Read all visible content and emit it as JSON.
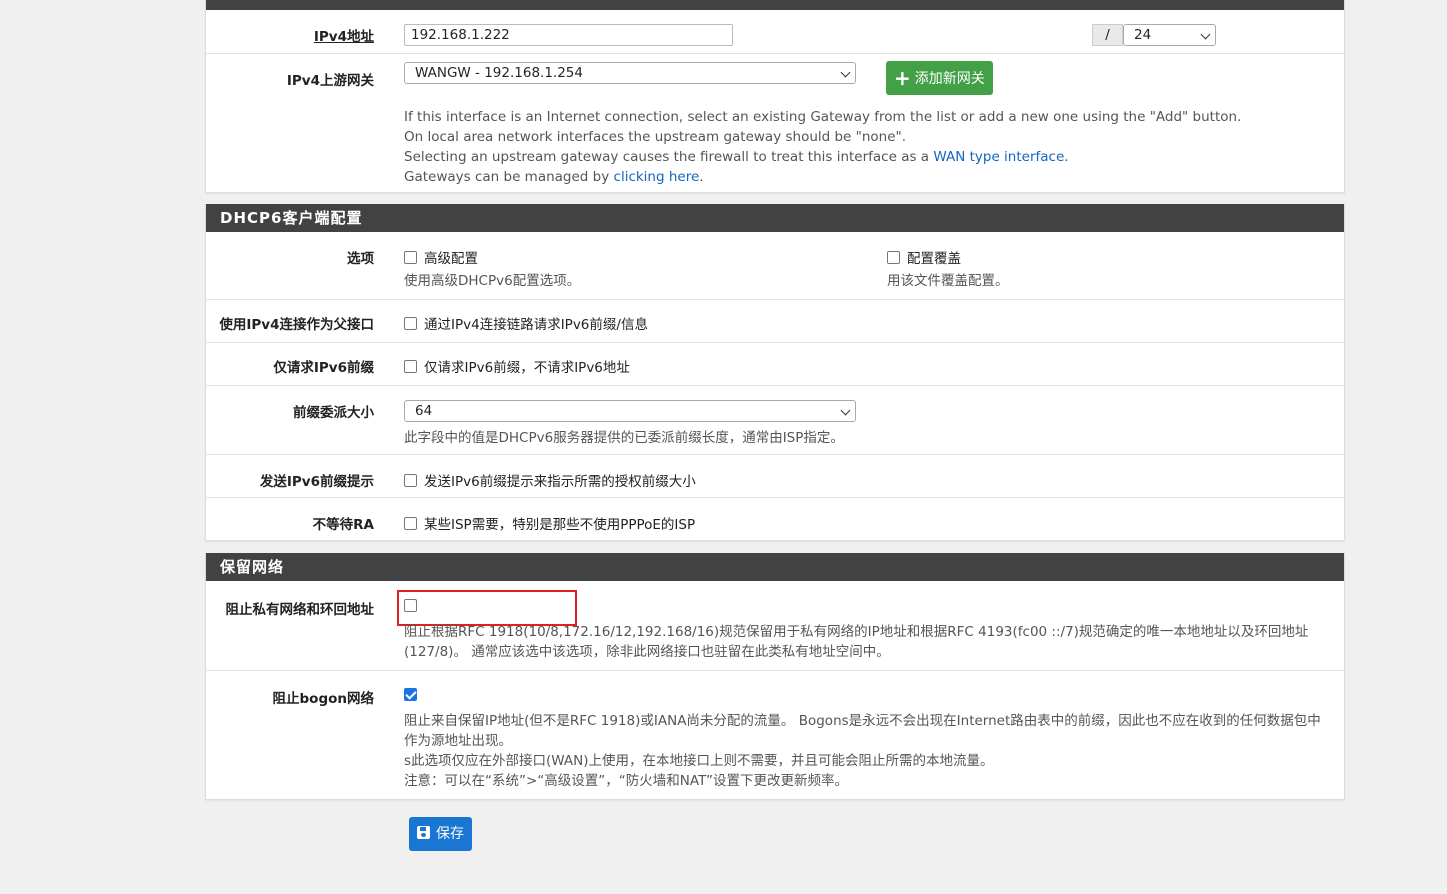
{
  "ipv4": {
    "address_label": "IPv4地址",
    "address_value": "192.168.1.222",
    "slash": "/",
    "mask_value": "24",
    "gateway_label": "IPv4上游网关",
    "gateway_value": "WANGW - 192.168.1.254",
    "add_gateway_button": "添加新网关",
    "help_line1": "If this interface is an Internet connection, select an existing Gateway from the list or add a new one using the \"Add\" button.",
    "help_line2": "On local area network interfaces the upstream gateway should be \"none\".",
    "help_line3_prefix": "Selecting an upstream gateway causes the firewall to treat this interface as a ",
    "help_line3_link": "WAN type interface",
    "help_line3_suffix": ".",
    "help_line4_prefix": "Gateways can be managed by ",
    "help_line4_link": "clicking here",
    "help_line4_suffix": "."
  },
  "dhcp6": {
    "heading": "DHCP6客户端配置",
    "options_label": "选项",
    "advanced_label": "高级配置",
    "advanced_help": "使用高级DHCPv6配置选项。",
    "override_label": "配置覆盖",
    "override_help": "用该文件覆盖配置。",
    "parent_label": "使用IPv4连接作为父接口",
    "parent_cb": "通过IPv4连接链路请求IPv6前缀/信息",
    "prefix_only_label": "仅请求IPv6前缀",
    "prefix_only_cb": "仅请求IPv6前缀，不请求IPv6地址",
    "delegation_label": "前缀委派大小",
    "delegation_value": "64",
    "delegation_help": "此字段中的值是DHCPv6服务器提供的已委派前缀长度，通常由ISP指定。",
    "hint_label": "发送IPv6前缀提示",
    "hint_cb": "发送IPv6前缀提示来指示所需的授权前缀大小",
    "nowait_label": "不等待RA",
    "nowait_cb": "某些ISP需要，特别是那些不使用PPPoE的ISP"
  },
  "reserved": {
    "heading": "保留网络",
    "private_label": "阻止私有网络和环回地址",
    "private_checked": false,
    "private_help1": "阻止根据RFC 1918(10/8,172.16/12,192.168/16)规范保留用于私有网络的IP地址和根据RFC 4193(fc00 ::/7)规范确定的唯一本地地址以及环回地址",
    "private_help2": "(127/8)。 通常应该选中该选项，除非此网络接口也驻留在此类私有地址空间中。",
    "bogon_label": "阻止bogon网络",
    "bogon_checked": true,
    "bogon_help1": "阻止来自保留IP地址(但不是RFC 1918)或IANA尚未分配的流量。 Bogons是永远不会出现在Internet路由表中的前缀，因此也不应在收到的任何数据包中",
    "bogon_help2": "作为源地址出现。",
    "bogon_help3": "s此选项仅应在外部接口(WAN)上使用，在本地接口上则不需要，并且可能会阻止所需的本地流量。",
    "bogon_help4": "注意：可以在“系统”>“高级设置”，“防火墙和NAT”设置下更改更新频率。"
  },
  "save_button": "保存",
  "colors": {
    "heading_bg": "#424242",
    "add_button": "#43a047",
    "save_button": "#1976d2",
    "link": "#1565c0",
    "highlight": "#e02020"
  }
}
